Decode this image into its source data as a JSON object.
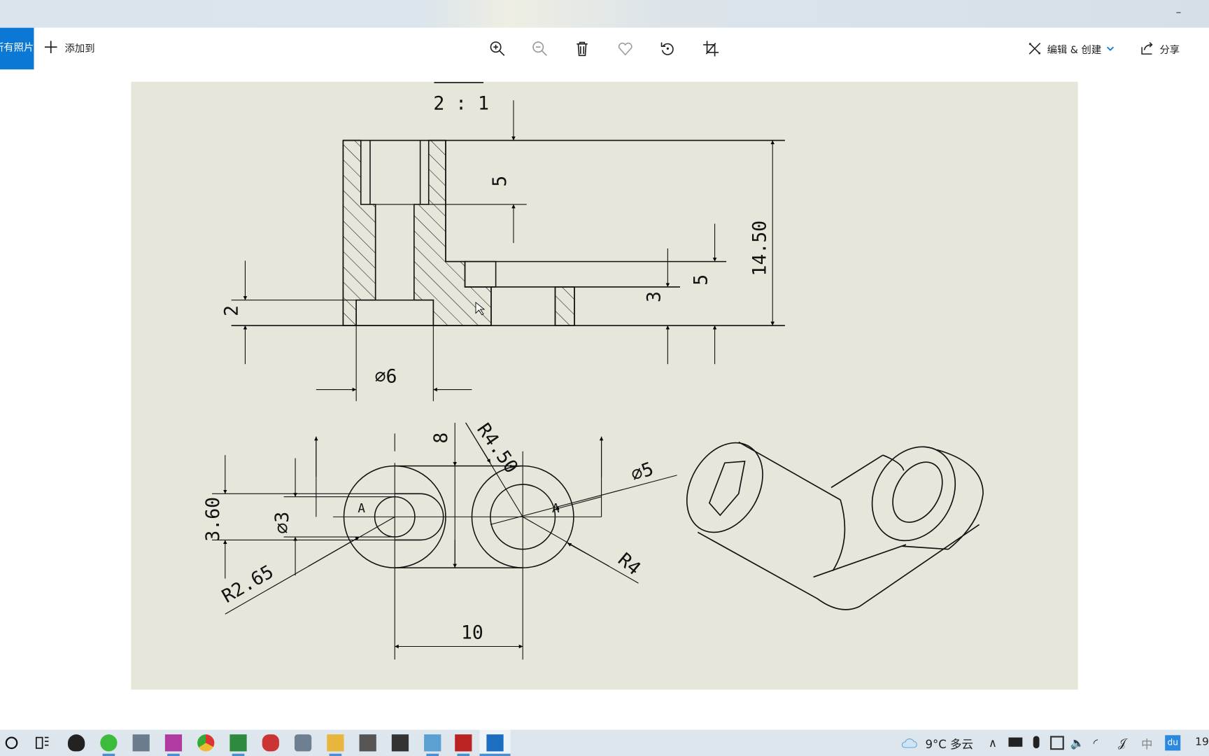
{
  "window": {
    "minimize_glyph": "–"
  },
  "toolbar": {
    "all_photos_label": "所有照片",
    "add_to_label": "添加到",
    "icons": [
      "zoom-in-icon",
      "zoom-out-icon",
      "delete-icon",
      "favorite-icon",
      "rotate-icon",
      "crop-icon"
    ],
    "edit_create_label": "编辑 & 创建",
    "share_label": "分享"
  },
  "drawing": {
    "scale_label": "2 : 1",
    "dims": {
      "d5_top": "5",
      "d14_50": "14.50",
      "d5_right": "5",
      "d3": "3",
      "d2": "2",
      "phi6": "∅6",
      "d8": "8",
      "r4_50": "R4.50",
      "phi5": "∅5",
      "r4": "R4",
      "phi3": "∅3",
      "d3_60": "3.60",
      "r2_65": "R2.65",
      "d10": "10"
    },
    "section_marks": [
      "A",
      "A"
    ]
  },
  "taskbar": {
    "weather": "9°C 多云",
    "ime": "中",
    "clock_partial": "19",
    "apps": [
      "search",
      "task-view",
      "qq",
      "wechat",
      "calculator",
      "app",
      "chrome",
      "vim",
      "app",
      "camera",
      "file-explorer",
      "app",
      "terminal",
      "app",
      "solidworks",
      "photos"
    ]
  }
}
